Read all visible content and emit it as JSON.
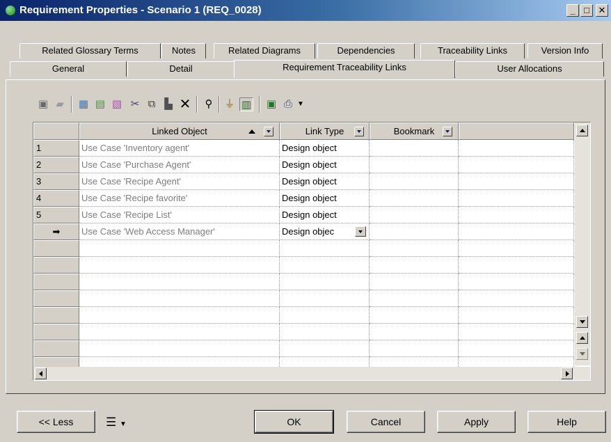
{
  "window": {
    "title": "Requirement Properties - Scenario 1 (REQ_0028)",
    "minimize": "_",
    "maximize": "□",
    "close": "✕"
  },
  "tabs_row1": [
    "Related Glossary Terms",
    "Notes",
    "Related Diagrams",
    "Dependencies",
    "Traceability Links",
    "Version Info"
  ],
  "tabs_row2": [
    "General",
    "Detail",
    "Requirement Traceability Links",
    "User Allocations"
  ],
  "active_tab": "Requirement Traceability Links",
  "toolbar": {
    "icons": [
      "properties-icon",
      "open-folder-icon",
      "add-rows-icon",
      "insert-row-icon",
      "add-objects-icon",
      "cut-icon",
      "copy-icon",
      "paste-icon",
      "delete-icon",
      "find-icon",
      "filter-icon",
      "customize-columns-icon",
      "excel-icon",
      "print-icon",
      "dropdown-arrow-icon"
    ]
  },
  "grid": {
    "columns": [
      "Linked Object",
      "Link Type",
      "Bookmark"
    ],
    "rows": [
      {
        "num": "1",
        "object": "Use Case 'Inventory agent'",
        "link_type": "Design object",
        "bookmark": ""
      },
      {
        "num": "2",
        "object": "Use Case 'Purchase Agent'",
        "link_type": "Design object",
        "bookmark": ""
      },
      {
        "num": "3",
        "object": "Use Case 'Recipe Agent'",
        "link_type": "Design object",
        "bookmark": ""
      },
      {
        "num": "4",
        "object": "Use Case 'Recipe favorite'",
        "link_type": "Design object",
        "bookmark": ""
      },
      {
        "num": "5",
        "object": "Use Case 'Recipe List'",
        "link_type": "Design object",
        "bookmark": ""
      },
      {
        "num": "➡",
        "object": "Use Case 'Web Access Manager'",
        "link_type": "Design objec",
        "bookmark": ""
      }
    ],
    "current_row_marker": "➡"
  },
  "buttons": {
    "less": "<< Less",
    "ok": "OK",
    "cancel": "Cancel",
    "apply": "Apply",
    "help": "Help"
  },
  "colors": {
    "title_start": "#0a246a",
    "title_end": "#a6caf0",
    "face": "#d4d0c8",
    "linked_object_text": "#7d7d7d"
  }
}
